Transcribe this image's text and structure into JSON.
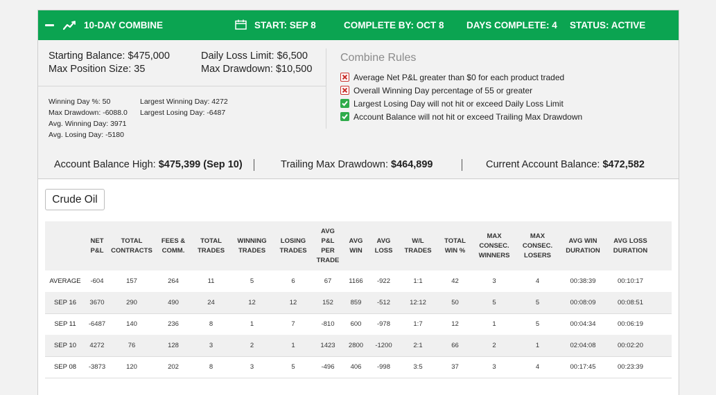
{
  "header": {
    "title": "10-DAY COMBINE",
    "start": "START: SEP 8",
    "complete_by": "COMPLETE BY: OCT 8",
    "days_complete": "DAYS COMPLETE: 4",
    "status": "STATUS: ACTIVE"
  },
  "account": {
    "starting_balance": "Starting Balance: $475,000",
    "max_position_size": "Max Position Size: 35",
    "daily_loss_limit": "Daily Loss Limit: $6,500",
    "max_drawdown": "Max Drawdown: $10,500"
  },
  "stats": {
    "winning_day_pct": "Winning Day %: 50",
    "max_drawdown": "Max Drawdown: -6088.0",
    "avg_winning_day": "Avg. Winning Day: 3971",
    "avg_losing_day": "Avg. Losing Day: -5180",
    "largest_winning_day": "Largest Winning Day: 4272",
    "largest_losing_day": "Largest Losing Day: -6487"
  },
  "rules": {
    "title": "Combine Rules",
    "items": [
      {
        "text": "Average Net P&L greater than $0 for each product traded",
        "status": "fail"
      },
      {
        "text": "Overall Winning Day percentage of 55 or greater",
        "status": "fail"
      },
      {
        "text": "Largest Losing Day will not hit or exceed Daily Loss Limit",
        "status": "pass"
      },
      {
        "text": "Account Balance will not hit or exceed Trailing Max Drawdown",
        "status": "pass"
      }
    ]
  },
  "balances": {
    "high_label": "Account Balance High: ",
    "high_value": "$475,399 (Sep 10)",
    "trailing_label": "Trailing Max Drawdown: ",
    "trailing_value": "$464,899",
    "current_label": "Current Account Balance: ",
    "current_value": "$472,582"
  },
  "product_tab": "Crude Oil",
  "table": {
    "columns": [
      [
        "",
        ""
      ],
      [
        "NET",
        "P&L"
      ],
      [
        "TOTAL",
        "CONTRACTS"
      ],
      [
        "FEES &",
        "COMM."
      ],
      [
        "TOTAL",
        "TRADES"
      ],
      [
        "WINNING",
        "TRADES"
      ],
      [
        "LOSING",
        "TRADES"
      ],
      [
        "AVG",
        "P&L",
        "PER",
        "TRADE"
      ],
      [
        "AVG",
        "WIN"
      ],
      [
        "AVG",
        "LOSS"
      ],
      [
        "W/L",
        "TRADES"
      ],
      [
        "TOTAL",
        "WIN %"
      ],
      [
        "MAX",
        "CONSEC.",
        "WINNERS"
      ],
      [
        "MAX",
        "CONSEC.",
        "LOSERS"
      ],
      [
        "AVG WIN",
        "DURATION"
      ],
      [
        "AVG LOSS",
        "DURATION"
      ]
    ],
    "rows": [
      [
        "AVERAGE",
        "-604",
        "157",
        "264",
        "11",
        "5",
        "6",
        "67",
        "1166",
        "-922",
        "1:1",
        "42",
        "3",
        "4",
        "00:38:39",
        "00:10:17"
      ],
      [
        "SEP 16",
        "3670",
        "290",
        "490",
        "24",
        "12",
        "12",
        "152",
        "859",
        "-512",
        "12:12",
        "50",
        "5",
        "5",
        "00:08:09",
        "00:08:51"
      ],
      [
        "SEP 11",
        "-6487",
        "140",
        "236",
        "8",
        "1",
        "7",
        "-810",
        "600",
        "-978",
        "1:7",
        "12",
        "1",
        "5",
        "00:04:34",
        "00:06:19"
      ],
      [
        "SEP 10",
        "4272",
        "76",
        "128",
        "3",
        "2",
        "1",
        "1423",
        "2800",
        "-1200",
        "2:1",
        "66",
        "2",
        "1",
        "02:04:08",
        "00:02:20"
      ],
      [
        "SEP 08",
        "-3873",
        "120",
        "202",
        "8",
        "3",
        "5",
        "-496",
        "406",
        "-998",
        "3:5",
        "37",
        "3",
        "4",
        "00:17:45",
        "00:23:39"
      ]
    ]
  },
  "colors": {
    "header_green": "#0ba451",
    "fail_red": "#c9302c",
    "pass_green": "#2eab4a"
  }
}
